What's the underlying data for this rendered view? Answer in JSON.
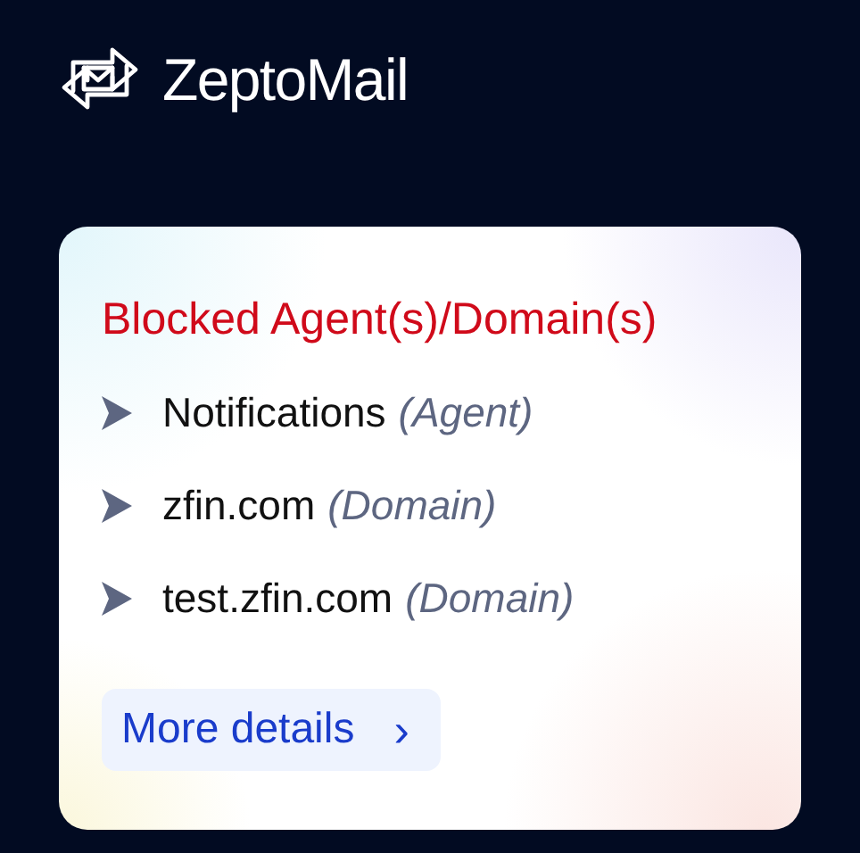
{
  "brand": {
    "name": "ZeptoMail"
  },
  "card": {
    "title": "Blocked Agent(s)/Domain(s)",
    "items": [
      {
        "name": "Notifications",
        "type": "(Agent)"
      },
      {
        "name": "zfin.com",
        "type": "(Domain)"
      },
      {
        "name": "test.zfin.com",
        "type": "(Domain)"
      }
    ],
    "link": {
      "label": "More details",
      "icon": "›"
    }
  }
}
